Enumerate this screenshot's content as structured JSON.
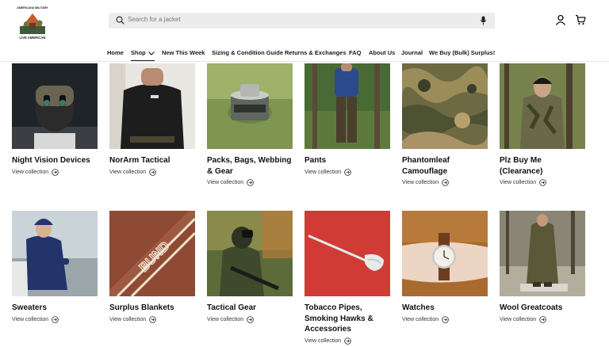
{
  "header": {
    "logo_icon": "american-apparel-logo",
    "logo_text_top": "AMERICANA MILITARY",
    "logo_text_bottom": "LIVE AMERICAN",
    "search_placeholder": "Search for a jacket",
    "search_icon": "search-icon",
    "mic_icon": "microphone-icon",
    "account_icon": "account-icon",
    "cart_icon": "cart-icon"
  },
  "nav": {
    "items": [
      {
        "label": "Home"
      },
      {
        "label": "Shop",
        "active": true
      },
      {
        "label": "New This Week"
      },
      {
        "label": "Sizing & Condition Guide"
      },
      {
        "label": "Returns & Exchanges"
      },
      {
        "label": "FAQ"
      },
      {
        "label": "About Us"
      },
      {
        "label": "Journal"
      },
      {
        "label": "We Buy (Bulk) Surplus!"
      }
    ]
  },
  "collections": [
    {
      "title": "Night Vision Devices",
      "link": "View collection"
    },
    {
      "title": "NorArm Tactical",
      "link": "View collection"
    },
    {
      "title": "Packs, Bags, Webbing & Gear",
      "link": "View collection"
    },
    {
      "title": "Pants",
      "link": "View collection"
    },
    {
      "title": "Phantomleaf Camouflage",
      "link": "View collection"
    },
    {
      "title": "Plz Buy Me (Clearance)",
      "link": "View collection"
    },
    {
      "title": "Sweaters",
      "link": "View collection"
    },
    {
      "title": "Surplus Blankets",
      "link": "View collection"
    },
    {
      "title": "Tactical Gear",
      "link": "View collection"
    },
    {
      "title": "Tobacco Pipes, Smoking Hawks & Accessories",
      "link": "View collection"
    },
    {
      "title": "Watches",
      "link": "View collection"
    },
    {
      "title": "Wool Greatcoats",
      "link": "View collection"
    }
  ],
  "blanket_text": "BUND"
}
